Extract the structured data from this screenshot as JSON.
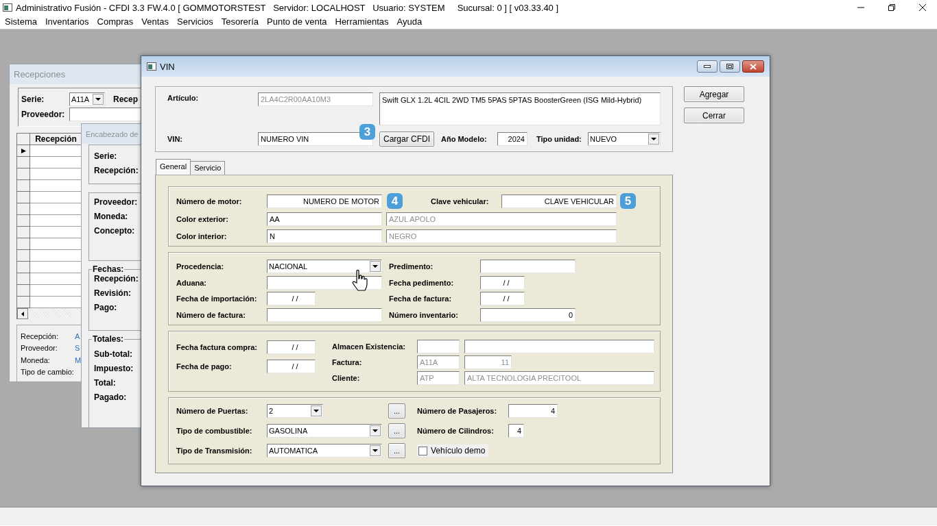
{
  "app_window": {
    "title": "Administrativo Fusión - CFDI 3.3 FW.4.0 [ GOMMOTORSTEST   Servidor: LOCALHOST   Usuario: SYSTEM     Sucursal: 0 ] [ v03.33.40 ]",
    "menu": [
      "Sistema",
      "Inventarios",
      "Compras",
      "Ventas",
      "Servicios",
      "Tesorería",
      "Punto de venta",
      "Herramientas",
      "Ayuda"
    ]
  },
  "recepciones_window": {
    "title": "Recepciones",
    "serie": {
      "label": "Serie:",
      "value": "A11A"
    },
    "recepcion_label": "Recep",
    "proveedor_label": "Proveedor:",
    "grid_header": "Recepción",
    "rows": [
      {
        "current": true
      },
      {
        "current": false
      },
      {
        "current": false
      },
      {
        "current": false
      },
      {
        "current": false
      },
      {
        "current": false
      },
      {
        "current": false
      },
      {
        "current": false
      },
      {
        "current": false
      },
      {
        "current": false
      },
      {
        "current": false
      },
      {
        "current": false
      },
      {
        "current": false
      },
      {
        "current": false
      }
    ],
    "summary": [
      {
        "label": "Recepción:",
        "value": "A"
      },
      {
        "label": "Proveedor:",
        "value": "S"
      },
      {
        "label": "Moneda:",
        "value": "M"
      },
      {
        "label": "Tipo de cambio:"
      }
    ]
  },
  "encabezado_window": {
    "title": "Encabezado de",
    "groups": [
      {
        "labels": [
          "Serie:",
          "Recepción:"
        ]
      },
      {
        "labels": [
          "Proveedor:",
          "Moneda:",
          "Concepto:"
        ]
      },
      {
        "legend": "Fechas:",
        "labels": [
          "Recepción:",
          "Revisión:",
          "Pago:"
        ]
      },
      {
        "legend": "Totales:",
        "labels": [
          "Sub-total:",
          "Impuesto:",
          "Total:",
          "Pagado:"
        ]
      }
    ]
  },
  "vin_dialog": {
    "title": "VIN",
    "buttons": [
      "Agregar",
      "Cerrar"
    ],
    "articulo": {
      "label": "Artículo:",
      "code": {
        "value": "2LA4C2R00AA10M3",
        "disabled": true
      },
      "description": {
        "value": "Swift GLX 1.2L 4CIL 2WD TM5 5PAS 5PTAS BoosterGreen (ISG Mild-Hybrid)",
        "disabled": false
      }
    },
    "vin": {
      "label": "VIN:",
      "value": "NUMERO VIN",
      "badge": "3"
    },
    "load_button": "Cargar CFDI",
    "model_year": {
      "label": "Año Modelo:",
      "value": "2024"
    },
    "unit_type": {
      "label": "Tipo unidad:",
      "value": "NUEVO"
    },
    "tabs": [
      {
        "label": "General",
        "selected": true
      },
      {
        "label": "Servicio",
        "selected": false
      }
    ],
    "engine_group": {
      "motor": {
        "label": "Número de motor:",
        "value": "NUMERO DE MOTOR",
        "badge": "4"
      },
      "clave": {
        "label": "Clave vehicular:",
        "value": "CLAVE VEHICULAR",
        "badge": "5"
      },
      "colors": [
        {
          "label": "Color exterior:",
          "code": {
            "value": "AA",
            "disabled": false
          },
          "name": {
            "value": "AZUL APOLO",
            "disabled": true
          }
        },
        {
          "label": "Color interior:",
          "code": {
            "value": "N",
            "disabled": false
          },
          "name": {
            "value": "NEGRO",
            "disabled": true
          }
        }
      ]
    },
    "origin_group": {
      "rows": [
        {
          "left": {
            "label": "Procedencia:",
            "kind": "select",
            "value": "NACIONAL"
          },
          "right": {
            "label": "Predimento:",
            "kind": "text"
          }
        },
        {
          "left": {
            "label": "Aduana:",
            "kind": "text"
          },
          "right": {
            "label": "Fecha pedimento:",
            "kind": "date",
            "value": "/ /"
          }
        },
        {
          "left": {
            "label": "Fecha de importación:",
            "kind": "date",
            "value": "/ /"
          },
          "right": {
            "label": "Fecha de factura:",
            "kind": "date",
            "value": "/ /"
          }
        },
        {
          "left": {
            "label": "Número de factura:",
            "kind": "text"
          },
          "right": {
            "label": "Número inventario:",
            "kind": "number",
            "value": "0"
          }
        }
      ]
    },
    "purchase_group": {
      "dates": [
        {
          "label": "Fecha factura compra:",
          "value": "/ /"
        },
        {
          "label": "Fecha de pago:",
          "value": "/ /"
        }
      ],
      "refs": [
        {
          "label": "Almacen Existencia:",
          "kind": "lookup"
        },
        {
          "label": "Factura:",
          "kind": "folio",
          "code": {
            "value": "A11A",
            "disabled": true
          },
          "name": {
            "value": "11",
            "disabled": true
          }
        },
        {
          "label": "Cliente:",
          "kind": "lookup",
          "code": {
            "value": "ATP",
            "disabled": true
          },
          "name": {
            "value": "ALTA TECNOLOGIA PRECITOOL",
            "disabled": true
          }
        }
      ]
    },
    "vehicle_group": {
      "rows": [
        {
          "label": "Número de Puertas:",
          "select": {
            "value": "2",
            "kind": "short"
          },
          "button": "...",
          "right": {
            "label": "Número de Pasajeros:",
            "kind": "number",
            "value": "4"
          }
        },
        {
          "label": "Tipo de combustible:",
          "select": {
            "value": "GASOLINA",
            "kind": "wide"
          },
          "button": "...",
          "right": {
            "label": "Número de Cilindros:",
            "kind": "spin",
            "value": "4"
          }
        },
        {
          "label": "Tipo de Transmisión:",
          "select": {
            "value": "AUTOMATICA",
            "kind": "wide"
          },
          "button": "...",
          "right": {
            "label": "Vehículo demo",
            "kind": "checkbox",
            "checked": false
          }
        }
      ]
    }
  }
}
